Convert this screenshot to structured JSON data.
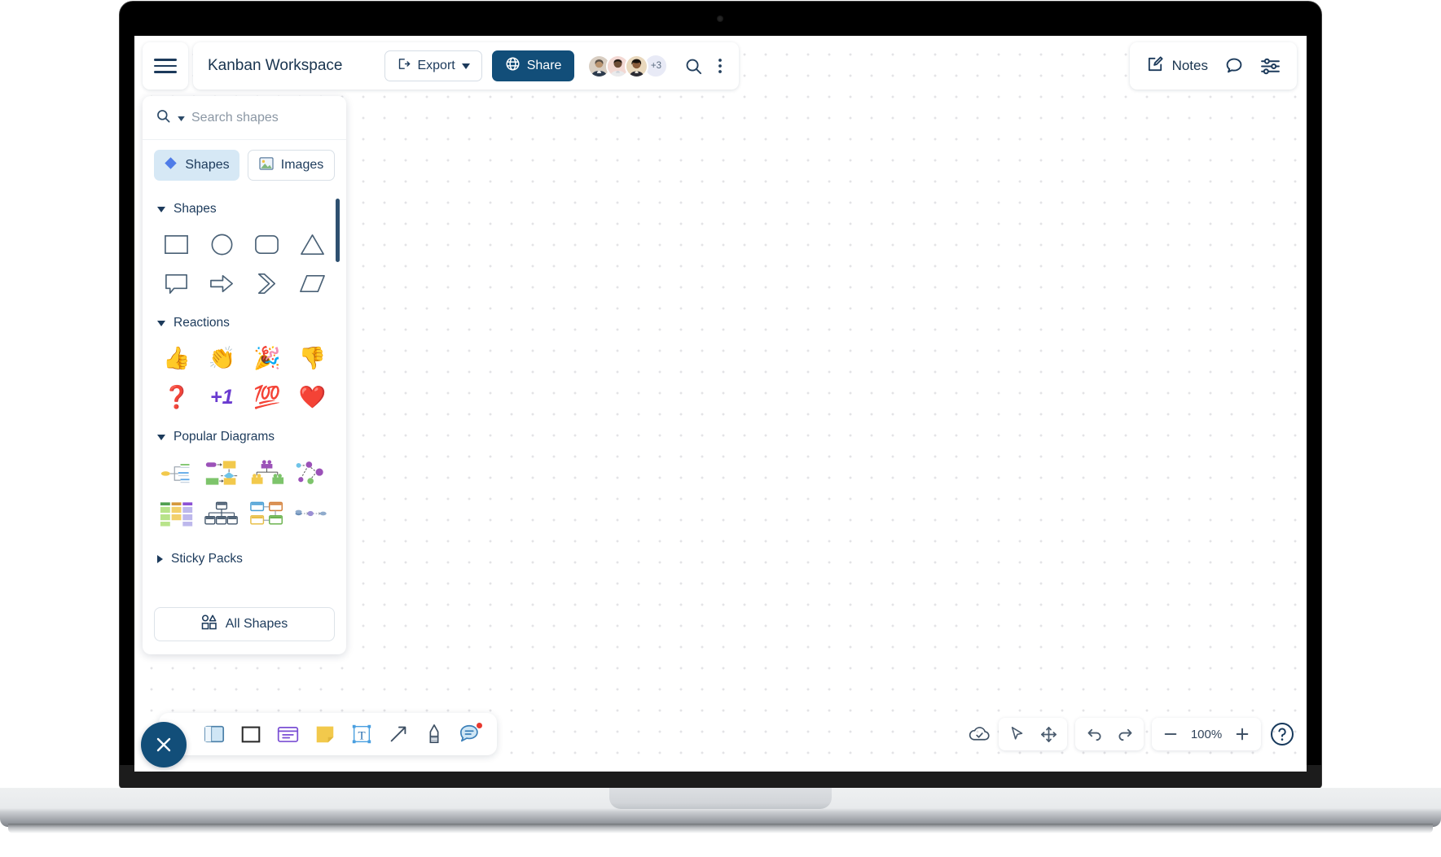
{
  "app": {
    "board_title": "Kanban Workspace"
  },
  "top_toolbar": {
    "menu_icon": "hamburger-menu-icon",
    "export_label": "Export",
    "export_icon": "export-icon",
    "export_caret_icon": "chevron-down-icon",
    "share_label": "Share",
    "share_icon": "globe-icon",
    "share_color": "#124e79",
    "search_icon": "search-icon",
    "more_icon": "more-vertical-icon",
    "avatars": [
      {
        "name": "collaborator-avatar-1",
        "bg": "#d8ccc0"
      },
      {
        "name": "collaborator-avatar-2",
        "bg": "#f2d6d2"
      },
      {
        "name": "collaborator-avatar-3",
        "bg": "#e8d5bb"
      }
    ],
    "avatar_overflow": "+3"
  },
  "notes_toolbar": {
    "notes_label": "Notes",
    "notes_icon": "edit-note-icon",
    "comment_icon": "comment-bubble-icon",
    "settings_icon": "sliders-icon"
  },
  "shapes_panel": {
    "search_placeholder": "Search shapes",
    "search_value": "",
    "search_icon": "search-icon",
    "search_caret_icon": "chevron-down-icon",
    "tabs": [
      {
        "label": "Shapes",
        "icon": "diamond-icon",
        "active": true
      },
      {
        "label": "Images",
        "icon": "image-icon",
        "active": false
      }
    ],
    "sections": [
      {
        "title": "Shapes",
        "expanded": true,
        "items": [
          {
            "name": "shape-rectangle"
          },
          {
            "name": "shape-circle"
          },
          {
            "name": "shape-rounded-rectangle"
          },
          {
            "name": "shape-triangle"
          },
          {
            "name": "shape-speech-callout"
          },
          {
            "name": "shape-block-arrow"
          },
          {
            "name": "shape-chevron"
          },
          {
            "name": "shape-parallelogram"
          }
        ]
      },
      {
        "title": "Reactions",
        "expanded": true,
        "items": [
          {
            "name": "reaction-thumbs-up",
            "glyph": "👍"
          },
          {
            "name": "reaction-clap",
            "glyph": "👏"
          },
          {
            "name": "reaction-party-popper",
            "glyph": "🎉"
          },
          {
            "name": "reaction-thumbs-down",
            "glyph": "👎"
          },
          {
            "name": "reaction-question-mark",
            "glyph": "❓"
          },
          {
            "name": "reaction-plus-one",
            "glyph": "+1"
          },
          {
            "name": "reaction-hundred",
            "glyph": "💯"
          },
          {
            "name": "reaction-heart",
            "glyph": "❤️"
          }
        ]
      },
      {
        "title": "Popular Diagrams",
        "expanded": true,
        "items": [
          {
            "name": "diagram-mind-map"
          },
          {
            "name": "diagram-flowchart"
          },
          {
            "name": "diagram-org-chart"
          },
          {
            "name": "diagram-network-diagram"
          },
          {
            "name": "diagram-swimlane-matrix"
          },
          {
            "name": "diagram-hierarchy-tree"
          },
          {
            "name": "diagram-entity-relationship"
          },
          {
            "name": "diagram-process-flow"
          }
        ]
      },
      {
        "title": "Sticky Packs",
        "expanded": false,
        "items": []
      }
    ],
    "all_shapes_label": "All Shapes",
    "all_shapes_icon": "shapes-grid-icon"
  },
  "bottom_toolbar": {
    "close_icon": "close-icon",
    "tools": [
      {
        "name": "tool-frame",
        "label": "Frame"
      },
      {
        "name": "tool-shape",
        "label": "Shape"
      },
      {
        "name": "tool-card",
        "label": "Card"
      },
      {
        "name": "tool-sticky-note",
        "label": "Sticky note"
      },
      {
        "name": "tool-text",
        "label": "Text"
      },
      {
        "name": "tool-connector",
        "label": "Connector"
      },
      {
        "name": "tool-highlighter",
        "label": "Highlighter"
      },
      {
        "name": "tool-comment",
        "label": "Comment",
        "badge": true
      }
    ]
  },
  "bottom_right": {
    "cloud_icon": "cloud-saved-icon",
    "cursor_icon": "cursor-select-icon",
    "pan_icon": "pan-move-icon",
    "undo_icon": "undo-icon",
    "redo_icon": "redo-icon",
    "zoom_out_icon": "minus-icon",
    "zoom_level": "100%",
    "zoom_in_icon": "plus-icon",
    "help_icon": "help-circle-icon"
  }
}
